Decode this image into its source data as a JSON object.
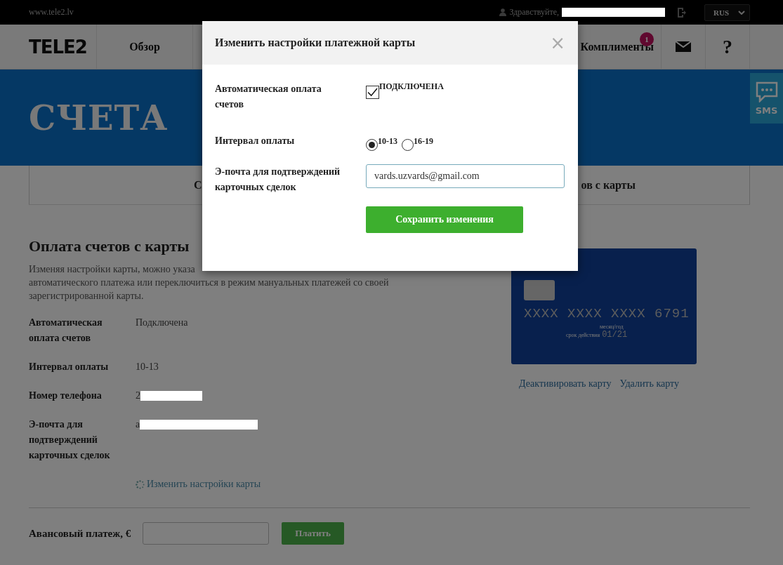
{
  "topbar": {
    "site": "www.tele2.lv",
    "greeting": "Здравствуйте,",
    "language": "RUS"
  },
  "nav": {
    "logo": "TELE2",
    "items": [
      {
        "label": "Обзор",
        "kind": "text"
      },
      {
        "label": "Комплименты",
        "kind": "text",
        "badge": "1"
      },
      {
        "kind": "mail"
      },
      {
        "label": "?",
        "kind": "text"
      }
    ]
  },
  "sms": {
    "label": "SMS"
  },
  "banner": {
    "title": "СЧЕТА"
  },
  "tabs": [
    {
      "label": "С"
    },
    {
      "label": "ов с карты"
    }
  ],
  "section": {
    "title": "Оплата счетов с карты",
    "description_lines": [
      "Изменяя настройки карты, можно указа",
      "автоматического платежа или переключиться в режим мануальных платежей со своей",
      "зарегистрированной карты."
    ],
    "rows": [
      {
        "label": "Автоматическая оплата счетов",
        "value": "Подключена",
        "redacted": false
      },
      {
        "label": "Интервал оплаты",
        "value": "10-13",
        "redacted": false
      },
      {
        "label": "Номер телефона",
        "value": "2",
        "redacted": true
      },
      {
        "label": "Э-почта для подтверждений карточных сделок",
        "value": "a",
        "redacted": true
      }
    ],
    "edit_link": "Изменить настройки карты"
  },
  "card": {
    "number": "XXXX XXXX XXXX 6791",
    "expiry_caption": "месяц/год",
    "valid_caption": "срок действия",
    "expiry": "01/21",
    "links": [
      "Деактивировать карту",
      "Удалить карту"
    ]
  },
  "advance": {
    "label": "Авансовый платеж, €",
    "button": "Платить"
  },
  "modal": {
    "title": "Изменить настройки платежной карты",
    "close": "×",
    "auto_label": "Автоматическая оплата счетов",
    "auto_checked": true,
    "auto_text": "ПОДКЛЮЧЕНА",
    "interval_label": "Интервал оплаты",
    "intervals": [
      {
        "label": "10-13",
        "selected": true
      },
      {
        "label": "16-19",
        "selected": false
      }
    ],
    "email_label": "Э-почта для подтверждений карточных сделок",
    "email": "vards.uzvards@gmail.com",
    "save": "Сохранить изменения"
  }
}
